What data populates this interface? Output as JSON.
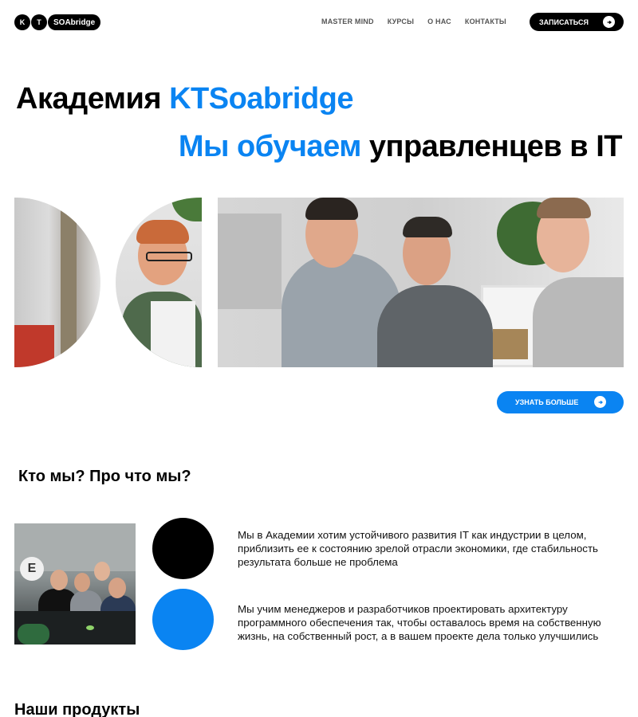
{
  "header": {
    "logo": {
      "letter1": "K",
      "letter2": "T",
      "name": "SOAbridge"
    },
    "nav": [
      "MASTER MIND",
      "КУРСЫ",
      "О НАС",
      "КОНТАКТЫ"
    ],
    "signup_label": "ЗАПИСАТЬСЯ"
  },
  "hero": {
    "title_plain": "Академия",
    "title_accent": "KTSoabridge",
    "subtitle_accent": "Мы обучаем",
    "subtitle_plain": "управленцев в IT",
    "learn_more_label": "УЗНАТЬ БОЛЬШЕ"
  },
  "about": {
    "title": "Кто мы? Про что мы?",
    "paragraphs": [
      "Мы в Академии хотим устойчивого развития IT как индустрии в целом, приблизить ее к состоянию зрелой отрасли экономики, где стабильность результата больше не проблема",
      "Мы учим менеджеров и разработчиков проектировать архитектуру программного обеспечения так, чтобы оставалось время на собственную жизнь, на собственный рост, а в вашем проекте дела только улучшились"
    ]
  },
  "products": {
    "title": "Наши продукты"
  },
  "colors": {
    "accent": "#0a84f2",
    "primary": "#000000",
    "background": "#ffffff"
  },
  "icons": {
    "button_arrow": "arrow-right-icon"
  }
}
